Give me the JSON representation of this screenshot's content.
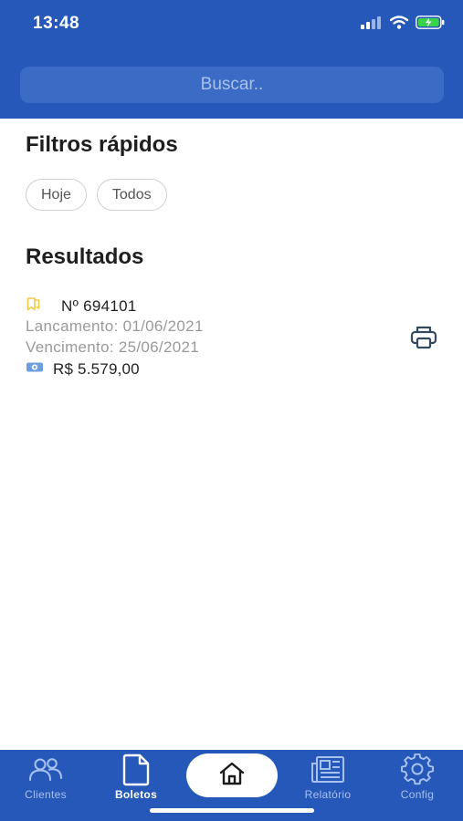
{
  "status_bar": {
    "time": "13:48"
  },
  "search": {
    "placeholder": "Buscar.."
  },
  "filters": {
    "title": "Filtros rápidos",
    "chips": [
      "Hoje",
      "Todos"
    ]
  },
  "results": {
    "title": "Resultados",
    "items": [
      {
        "number": "Nº 694101",
        "lancamento": "Lancamento: 01/06/2021",
        "vencimento": "Vencimento: 25/06/2021",
        "valor": "R$ 5.579,00"
      }
    ]
  },
  "tabbar": {
    "items": [
      {
        "label": "Clientes",
        "icon": "users-icon"
      },
      {
        "label": "Boletos",
        "icon": "document-icon",
        "active": true
      },
      {
        "label": "",
        "icon": "home-icon"
      },
      {
        "label": "Relatório",
        "icon": "newspaper-icon"
      },
      {
        "label": "Config",
        "icon": "gear-icon"
      }
    ]
  },
  "colors": {
    "primary": "#2558b8",
    "search_bg": "#3b6cc5",
    "bookmark": "#f2c94c",
    "money": "#6d9fe0"
  }
}
